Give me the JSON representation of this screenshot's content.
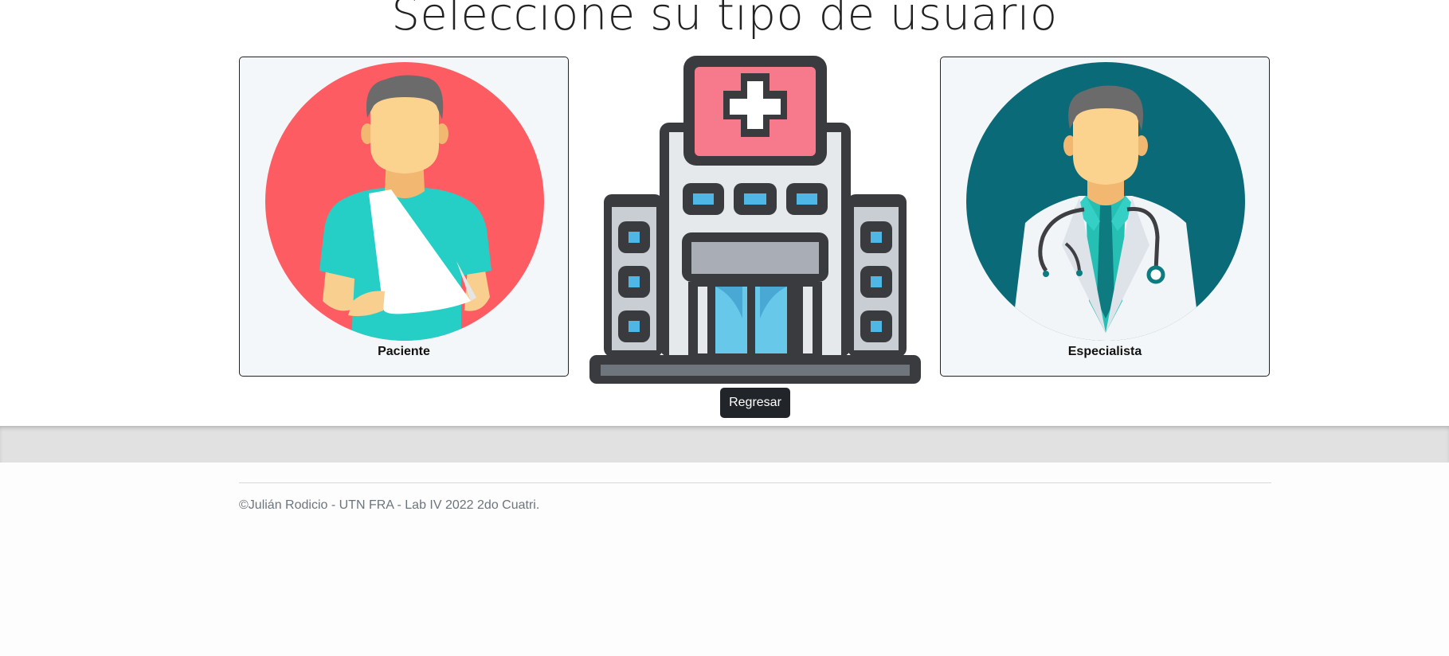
{
  "header": {
    "title": "Seleccione su tipo de usuario"
  },
  "cards": [
    {
      "label": "Paciente",
      "icon": "patient-avatar-icon",
      "circle_color": "#fd5c63"
    },
    {
      "label": "Especialista",
      "icon": "doctor-avatar-icon",
      "circle_color": "#0b6a78"
    }
  ],
  "center_image": {
    "icon": "hospital-icon"
  },
  "actions": {
    "back_label": "Regresar"
  },
  "footer": {
    "text": "©Julián Rodicio - UTN FRA - Lab IV 2022 2do Cuatri."
  },
  "colors": {
    "button_bg": "#212529",
    "card_bg": "#f4f7f9",
    "footer_band": "#e1e1e1"
  }
}
